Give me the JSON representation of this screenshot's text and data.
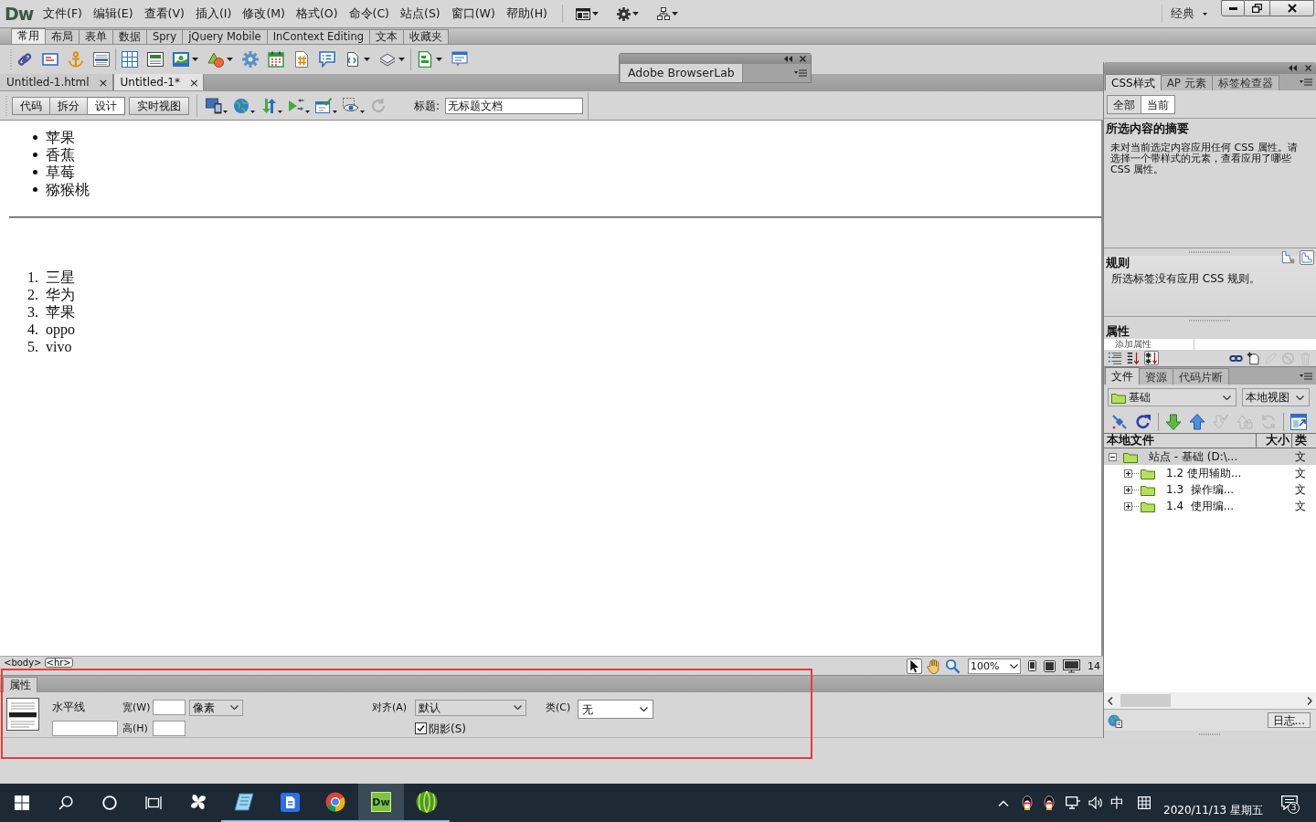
{
  "app_logo": "Dw",
  "menu_bar": [
    "文件(F)",
    "编辑(E)",
    "查看(V)",
    "插入(I)",
    "修改(M)",
    "格式(O)",
    "命令(C)",
    "站点(S)",
    "窗口(W)",
    "帮助(H)"
  ],
  "workspace": "经典",
  "insert_tabs": [
    {
      "label": "常用",
      "selected": true
    },
    {
      "label": "布局",
      "selected": false
    },
    {
      "label": "表单",
      "selected": false
    },
    {
      "label": "数据",
      "selected": false
    },
    {
      "label": "Spry",
      "selected": false
    },
    {
      "label": "jQuery Mobile",
      "selected": false
    },
    {
      "label": "InContext Editing",
      "selected": false
    },
    {
      "label": "文本",
      "selected": false
    },
    {
      "label": "收藏夹",
      "selected": false
    }
  ],
  "floating_panel": {
    "tab": "Adobe BrowserLab"
  },
  "document_tabs": [
    {
      "label": "Untitled-1.html",
      "close": "×",
      "selected": false
    },
    {
      "label": "Untitled-1*",
      "close": "×",
      "selected": true
    }
  ],
  "view_buttons": [
    {
      "label": "代码",
      "selected": false
    },
    {
      "label": "拆分",
      "selected": false
    },
    {
      "label": "设计",
      "selected": true
    },
    {
      "label": "实时视图",
      "selected": false
    }
  ],
  "document_toolbar": [
    {
      "kind": "multiscreen",
      "disabled": false
    },
    {
      "kind": "preview_browser",
      "disabled": false
    },
    {
      "kind": "file_management",
      "disabled": false
    },
    {
      "kind": "check_page",
      "disabled": false
    },
    {
      "kind": "visual_aids",
      "disabled": false
    },
    {
      "kind": "live_options",
      "disabled": false
    },
    {
      "kind": "refresh",
      "disabled": true
    }
  ],
  "title_field": {
    "label": "标题:",
    "value": "无标题文档"
  },
  "design_view": {
    "bulleted_list": [
      "苹果",
      "香蕉",
      "草莓",
      "猕猴桃"
    ],
    "numbered_list": [
      {
        "number": "1.",
        "text": "三星"
      },
      {
        "number": "2.",
        "text": "华为"
      },
      {
        "number": "3.",
        "text": "苹果"
      },
      {
        "number": "4.",
        "text": "oppo"
      },
      {
        "number": "5.",
        "text": "vivo"
      }
    ]
  },
  "status_bar": {
    "tags": [
      {
        "tag": "<body>",
        "selected": false
      },
      {
        "tag": "<hr>",
        "selected": true
      }
    ],
    "tools": [
      {
        "kind": "select",
        "selected": true
      },
      {
        "kind": "hand",
        "selected": false
      },
      {
        "kind": "zoom",
        "selected": false
      }
    ],
    "zoom": "100%",
    "window_size": "14"
  },
  "properties_panel": {
    "tab": "属性",
    "element": "水平线",
    "width_label": "宽(W)",
    "unit": "像素",
    "height_label": "高(H)",
    "align_label": "对齐(A)",
    "align": "默认",
    "shading": {
      "label": "阴影(S)",
      "checked": true
    },
    "class_label": "类(C)",
    "class": "无"
  },
  "css_panel": {
    "tabs": [
      {
        "label": "CSS样式",
        "selected": true
      },
      {
        "label": "AP 元素",
        "selected": false
      },
      {
        "label": "标签检查器",
        "selected": false
      }
    ],
    "modes": [
      {
        "label": "全部",
        "selected": false
      },
      {
        "label": "当前",
        "selected": true
      }
    ],
    "summary_title": "所选内容的摘要",
    "summary_text": "未对当前选定内容应用任何 CSS 属性。请选择一个带样式的元素，查看应用了哪些 CSS 属性。",
    "rules_title": "规则",
    "rule_views": [
      {
        "kind": "cascade",
        "selected": false
      },
      {
        "kind": "about",
        "selected": true
      }
    ],
    "rules_text": "所选标签没有应用 CSS 规则。",
    "properties_title": "属性",
    "add_property": "添加属性",
    "property_views": [
      {
        "kind": "category",
        "selected": false
      },
      {
        "kind": "alphabetical",
        "selected": false
      },
      {
        "kind": "set_only",
        "selected": true
      }
    ],
    "property_actions": [
      {
        "kind": "attach",
        "disabled": false
      },
      {
        "kind": "new_rule",
        "disabled": false
      },
      {
        "kind": "edit",
        "disabled": true
      },
      {
        "kind": "disable",
        "disabled": true
      },
      {
        "kind": "delete",
        "disabled": true
      }
    ]
  },
  "files_panel": {
    "tabs": [
      {
        "label": "文件",
        "selected": true
      },
      {
        "label": "资源",
        "selected": false
      },
      {
        "label": "代码片断",
        "selected": false
      }
    ],
    "site": "基础",
    "view": "本地视图",
    "toolbar": [
      [
        {
          "kind": "connect",
          "disabled": false
        },
        {
          "kind": "refresh",
          "disabled": false
        }
      ],
      [
        {
          "kind": "get",
          "disabled": false
        },
        {
          "kind": "put",
          "disabled": false
        },
        {
          "kind": "check_out",
          "disabled": true
        },
        {
          "kind": "check_in",
          "disabled": true
        },
        {
          "kind": "synchronize",
          "disabled": true
        }
      ],
      [
        {
          "kind": "expand",
          "disabled": false
        }
      ]
    ],
    "columns": [
      "本地文件",
      "大小",
      "类"
    ],
    "tree": [
      {
        "name": "站点 - 基础 (D:\\...",
        "type": "文",
        "expanded": true,
        "selected": true,
        "children": [
          {
            "name": "1.2 使用辅助...",
            "type": "文",
            "expanded": false,
            "selected": false
          },
          {
            "name": "1.3  操作编...",
            "type": "文",
            "expanded": false,
            "selected": false
          },
          {
            "name": "1.4  使用编...",
            "type": "文",
            "expanded": false,
            "selected": false
          }
        ]
      }
    ],
    "log_button": "日志..."
  },
  "taskbar": {
    "apps": [
      {
        "kind": "pinwheel",
        "running": false,
        "active": false
      },
      {
        "kind": "notebook",
        "running": true,
        "active": false
      },
      {
        "kind": "writer",
        "running": true,
        "active": false
      },
      {
        "kind": "browser",
        "running": true,
        "active": false
      },
      {
        "kind": "dreamweaver",
        "label": "Dw",
        "running": true,
        "active": true
      },
      {
        "kind": "melon",
        "running": true,
        "active": false
      }
    ],
    "ime": "中",
    "date": "2020/11/13 星期五",
    "notification_count": "3"
  }
}
